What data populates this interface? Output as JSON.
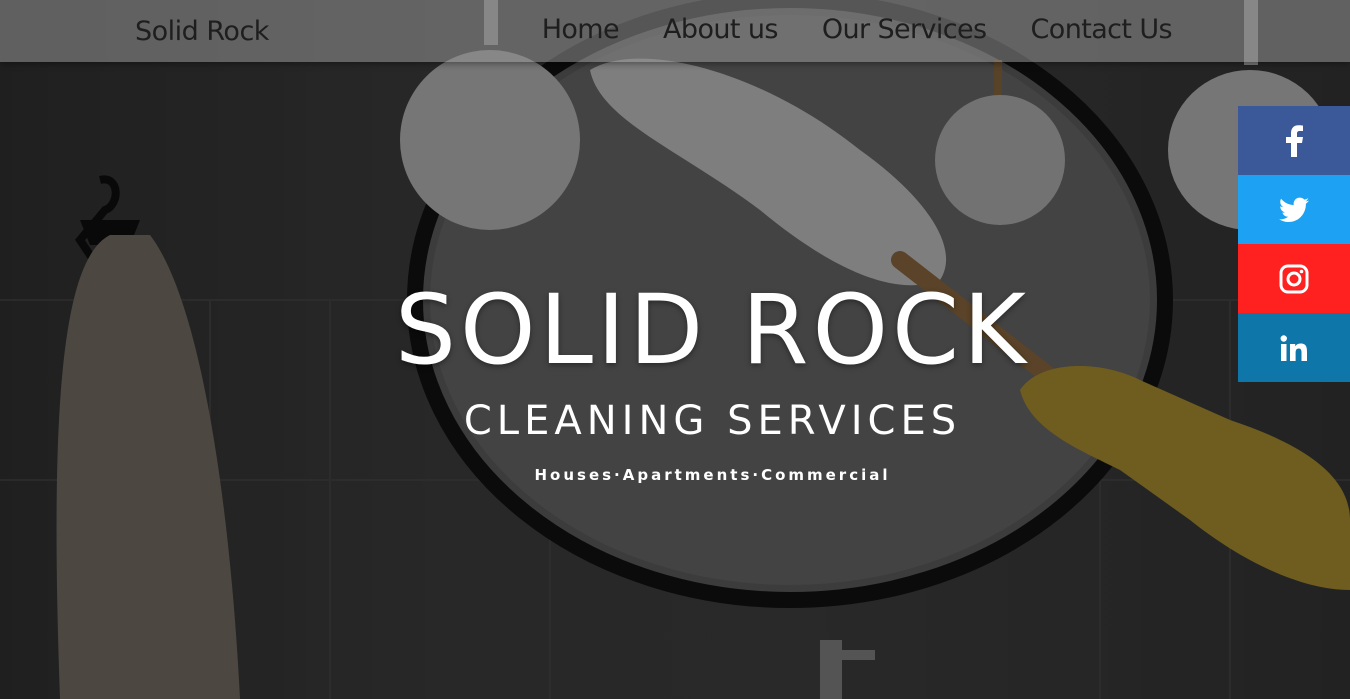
{
  "navbar": {
    "brand": "Solid Rock",
    "links": [
      "Home",
      "About us",
      "Our Services",
      "Contact Us"
    ]
  },
  "hero": {
    "title": "SOLID ROCK",
    "subtitle": "CLEANING SERVICES",
    "tagline": "Houses·Apartments·Commercial"
  },
  "social": {
    "items": [
      {
        "name": "facebook",
        "icon": "facebook-icon",
        "color": "#3b5998"
      },
      {
        "name": "twitter",
        "icon": "twitter-icon",
        "color": "#1da1f2"
      },
      {
        "name": "instagram",
        "icon": "instagram-icon",
        "color": "#ff2020"
      },
      {
        "name": "linkedin",
        "icon": "linkedin-icon",
        "color": "#0e76a8"
      }
    ]
  }
}
